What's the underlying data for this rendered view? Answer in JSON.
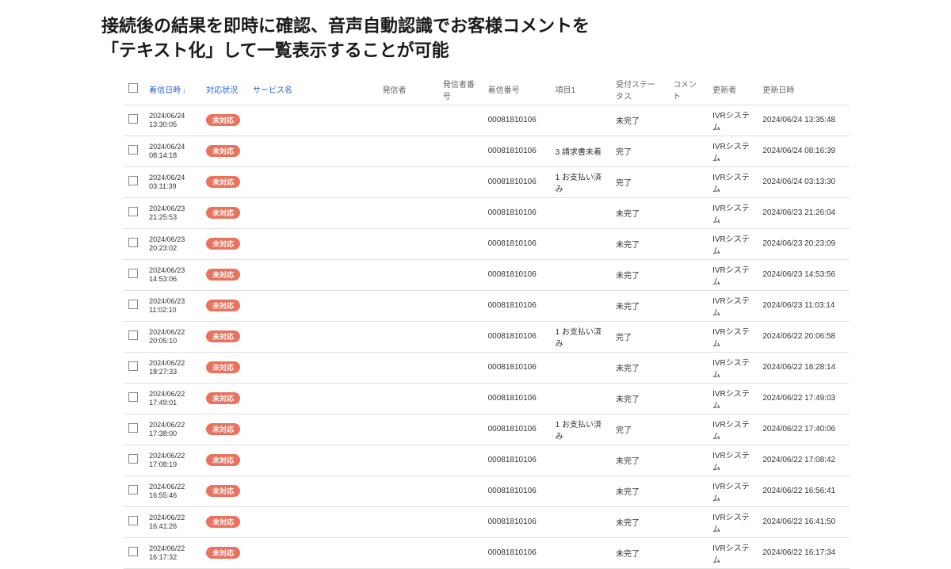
{
  "title_line1": "接続後の結果を即時に確認、音声自動認識でお客様コメントを",
  "title_line2": "「テキスト化」して一覧表示することが可能",
  "columns": {
    "check": "",
    "recv_dt": "着信日時",
    "status": "対応状況",
    "service": "サービス名",
    "sender": "発信者",
    "sender_tel": "発信者番号",
    "recv_tel": "着信番号",
    "item1": "項目1",
    "recv_status": "受付ステータス",
    "comment": "コメント",
    "updater": "更新者",
    "update_dt": "更新日時"
  },
  "rows": [
    {
      "dt1": "2024/06/24",
      "dt2": "13:30:05",
      "status": "未対応",
      "tel": "00081810106",
      "item": "",
      "rstat": "未完了",
      "upd": "IVRシステム",
      "updt": "2024/06/24 13:35:48"
    },
    {
      "dt1": "2024/06/24",
      "dt2": "08:14:18",
      "status": "未対応",
      "tel": "00081810106",
      "item": "3 請求書未着",
      "rstat": "完了",
      "upd": "IVRシステム",
      "updt": "2024/06/24 08:16:39"
    },
    {
      "dt1": "2024/06/24",
      "dt2": "03:11:39",
      "status": "未対応",
      "tel": "00081810106",
      "item": "1 お支払い済み",
      "rstat": "完了",
      "upd": "IVRシステム",
      "updt": "2024/06/24 03:13:30"
    },
    {
      "dt1": "2024/06/23",
      "dt2": "21:25:53",
      "status": "未対応",
      "tel": "00081810106",
      "item": "",
      "rstat": "未完了",
      "upd": "IVRシステム",
      "updt": "2024/06/23 21:26:04"
    },
    {
      "dt1": "2024/06/23",
      "dt2": "20:23:02",
      "status": "未対応",
      "tel": "00081810106",
      "item": "",
      "rstat": "未完了",
      "upd": "IVRシステム",
      "updt": "2024/06/23 20:23:09"
    },
    {
      "dt1": "2024/06/23",
      "dt2": "14:53:06",
      "status": "未対応",
      "tel": "00081810106",
      "item": "",
      "rstat": "未完了",
      "upd": "IVRシステム",
      "updt": "2024/06/23 14:53:56"
    },
    {
      "dt1": "2024/06/23",
      "dt2": "11:02:10",
      "status": "未対応",
      "tel": "00081810106",
      "item": "",
      "rstat": "未完了",
      "upd": "IVRシステム",
      "updt": "2024/06/23 11:03:14"
    },
    {
      "dt1": "2024/06/22",
      "dt2": "20:05:10",
      "status": "未対応",
      "tel": "00081810106",
      "item": "1 お支払い済み",
      "rstat": "完了",
      "upd": "IVRシステム",
      "updt": "2024/06/22 20:06:58"
    },
    {
      "dt1": "2024/06/22",
      "dt2": "18:27:33",
      "status": "未対応",
      "tel": "00081810106",
      "item": "",
      "rstat": "未完了",
      "upd": "IVRシステム",
      "updt": "2024/06/22 18:28:14"
    },
    {
      "dt1": "2024/06/22",
      "dt2": "17:49:01",
      "status": "未対応",
      "tel": "00081810106",
      "item": "",
      "rstat": "未完了",
      "upd": "IVRシステム",
      "updt": "2024/06/22 17:49:03"
    },
    {
      "dt1": "2024/06/22",
      "dt2": "17:38:00",
      "status": "未対応",
      "tel": "00081810106",
      "item": "1 お支払い済み",
      "rstat": "完了",
      "upd": "IVRシステム",
      "updt": "2024/06/22 17:40:06"
    },
    {
      "dt1": "2024/06/22",
      "dt2": "17:08:19",
      "status": "未対応",
      "tel": "00081810106",
      "item": "",
      "rstat": "未完了",
      "upd": "IVRシステム",
      "updt": "2024/06/22 17:08:42"
    },
    {
      "dt1": "2024/06/22",
      "dt2": "16:55:46",
      "status": "未対応",
      "tel": "00081810106",
      "item": "",
      "rstat": "未完了",
      "upd": "IVRシステム",
      "updt": "2024/06/22 16:56:41"
    },
    {
      "dt1": "2024/06/22",
      "dt2": "16:41:26",
      "status": "未対応",
      "tel": "00081810106",
      "item": "",
      "rstat": "未完了",
      "upd": "IVRシステム",
      "updt": "2024/06/22 16:41:50"
    },
    {
      "dt1": "2024/06/22",
      "dt2": "16:17:32",
      "status": "未対応",
      "tel": "00081810106",
      "item": "",
      "rstat": "未完了",
      "upd": "IVRシステム",
      "updt": "2024/06/22 16:17:34"
    }
  ]
}
